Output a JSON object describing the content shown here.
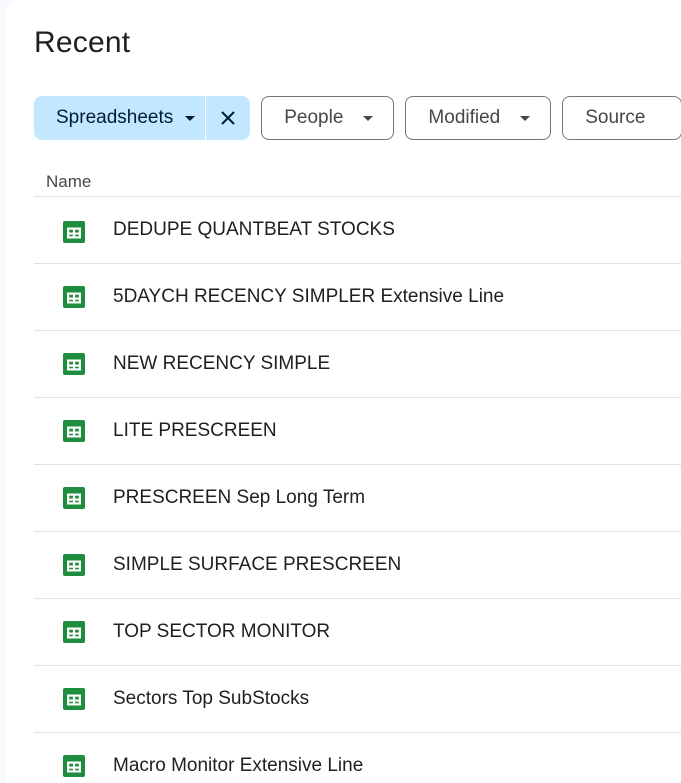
{
  "page": {
    "title": "Recent"
  },
  "filters": {
    "type_chip": {
      "label": "Spreadsheets",
      "active": true,
      "clear_icon": "close-icon"
    },
    "people_chip": {
      "label": "People"
    },
    "modified_chip": {
      "label": "Modified"
    },
    "source_chip": {
      "label": "Source"
    }
  },
  "table": {
    "name_header": "Name",
    "rows": [
      {
        "name": "DEDUPE QUANTBEAT STOCKS",
        "icon": "google-sheets-icon"
      },
      {
        "name": "5DAYCH RECENCY SIMPLER Extensive Line",
        "icon": "google-sheets-icon"
      },
      {
        "name": "NEW RECENCY SIMPLE",
        "icon": "google-sheets-icon"
      },
      {
        "name": "LITE PRESCREEN",
        "icon": "google-sheets-icon"
      },
      {
        "name": "PRESCREEN Sep Long Term",
        "icon": "google-sheets-icon"
      },
      {
        "name": "SIMPLE SURFACE PRESCREEN",
        "icon": "google-sheets-icon"
      },
      {
        "name": "TOP SECTOR MONITOR",
        "icon": "google-sheets-icon"
      },
      {
        "name": "Sectors Top SubStocks",
        "icon": "google-sheets-icon"
      },
      {
        "name": "Macro Monitor Extensive Line",
        "icon": "google-sheets-icon"
      }
    ]
  },
  "colors": {
    "sheets_green": "#1e8e3e",
    "active_chip_bg": "#c2e7ff",
    "active_chip_text": "#001d35"
  }
}
